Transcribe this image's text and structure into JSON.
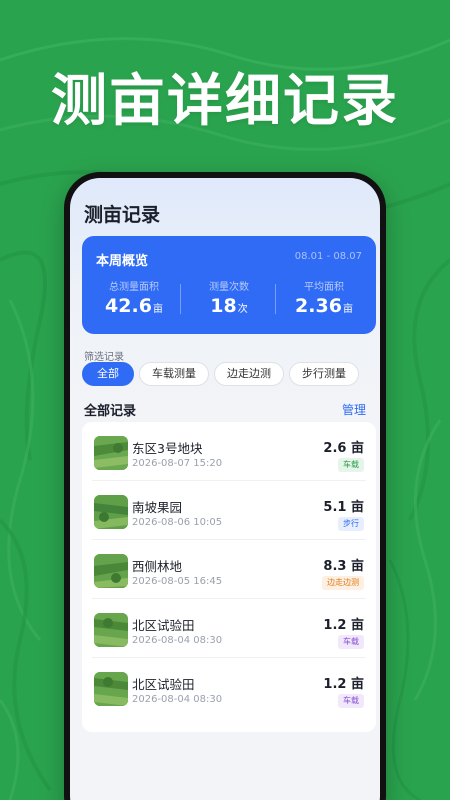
{
  "headline": "测亩详细记录",
  "app": {
    "title": "测亩记录"
  },
  "summary": {
    "title": "本周概览",
    "date_range": "08.01 - 08.07",
    "stats": [
      {
        "label": "总测量面积",
        "value": "42.6",
        "unit": "亩"
      },
      {
        "label": "测量次数",
        "value": "18",
        "unit": "次"
      },
      {
        "label": "平均面积",
        "value": "2.36",
        "unit": "亩"
      }
    ]
  },
  "filter": {
    "label": "筛选记录",
    "chips": [
      "全部",
      "车载测量",
      "边走边测",
      "步行测量"
    ]
  },
  "list": {
    "title": "全部记录",
    "manage_label": "管理",
    "records": [
      {
        "name": "东区3号地块",
        "time": "2026-08-07 15:20",
        "area": "2.6",
        "unit": "亩",
        "tag": "车载",
        "tag_color": "#2a9d4a",
        "tag_bg": "#e6f5ea"
      },
      {
        "name": "南坡果园",
        "time": "2026-08-06 10:05",
        "area": "5.1",
        "unit": "亩",
        "tag": "步行",
        "tag_color": "#2f6bf5",
        "tag_bg": "#e7eefd"
      },
      {
        "name": "西侧林地",
        "time": "2026-08-05 16:45",
        "area": "8.3",
        "unit": "亩",
        "tag": "边走边测",
        "tag_color": "#e07b1a",
        "tag_bg": "#fdefe1"
      },
      {
        "name": "北区试验田",
        "time": "2026-08-04 08:30",
        "area": "1.2",
        "unit": "亩",
        "tag": "车载",
        "tag_color": "#8a4fd6",
        "tag_bg": "#f1e8fb"
      },
      {
        "name": "北区试验田",
        "time": "2026-08-04 08:30",
        "area": "1.2",
        "unit": "亩",
        "tag": "车载",
        "tag_color": "#8a4fd6",
        "tag_bg": "#f1e8fb"
      }
    ]
  },
  "colors": {
    "background": "#2aa34e",
    "accent": "#2f6bf5"
  }
}
